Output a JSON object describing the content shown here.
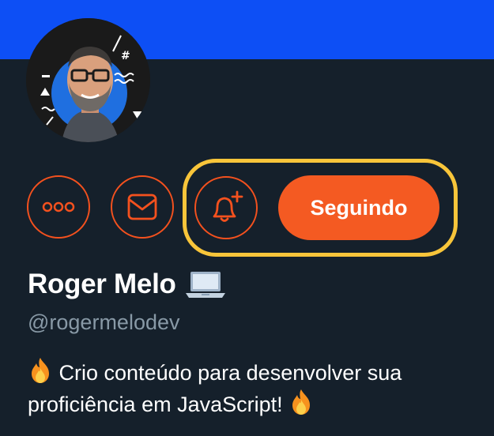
{
  "header": {
    "banner_color": "#0d4ff5"
  },
  "profile": {
    "avatar_icon": "avatar",
    "display_name": "Roger Melo",
    "name_emoji_icon": "laptop-icon",
    "handle": "@rogermelodev",
    "bio_line1": "Crio conteúdo para desenvolver sua",
    "bio_line2": "proficiência em JavaScript!"
  },
  "actions": {
    "more_icon": "more-dots-icon",
    "message_icon": "mail-icon",
    "notify_icon": "bell-plus-icon",
    "follow_label": "Seguindo"
  },
  "colors": {
    "accent": "#f45a22",
    "highlight": "#f8c53a",
    "background": "#15202b",
    "muted_text": "#8899a6"
  }
}
